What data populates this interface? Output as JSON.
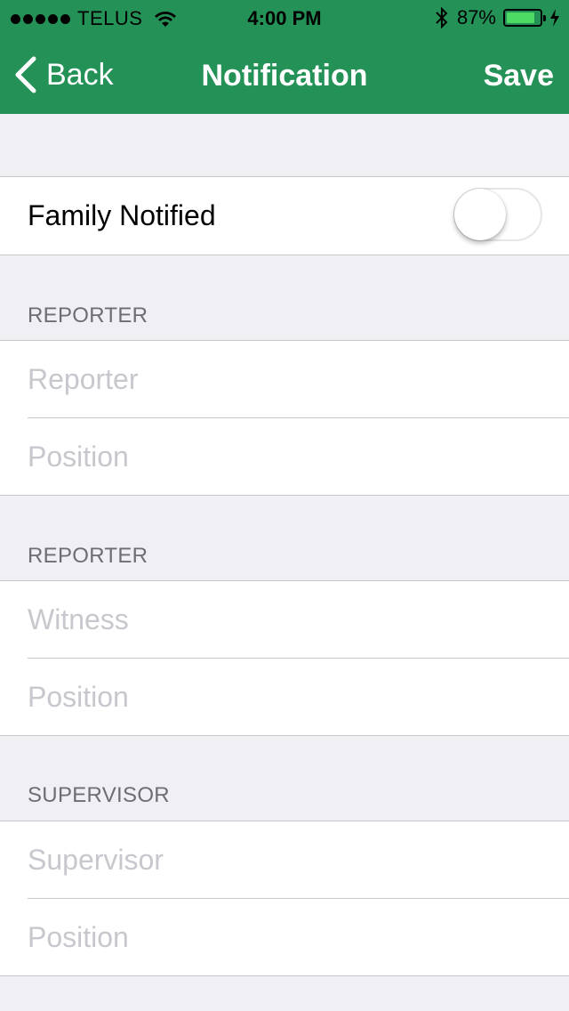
{
  "status_bar": {
    "carrier": "TELUS",
    "time": "4:00 PM",
    "battery_percent": "87%",
    "battery_level": 0.87,
    "icons": [
      "signal-dots-icon",
      "wifi-icon",
      "bluetooth-icon",
      "battery-icon",
      "charging-bolt-icon"
    ]
  },
  "nav": {
    "back_label": "Back",
    "title": "Notification",
    "save_label": "Save",
    "bar_color": "#249257"
  },
  "family_notified": {
    "label": "Family Notified",
    "on": false
  },
  "sections": [
    {
      "header": "REPORTER",
      "fields": [
        {
          "placeholder": "Reporter",
          "value": ""
        },
        {
          "placeholder": "Position",
          "value": ""
        }
      ]
    },
    {
      "header": "REPORTER",
      "fields": [
        {
          "placeholder": "Witness",
          "value": ""
        },
        {
          "placeholder": "Position",
          "value": ""
        }
      ]
    },
    {
      "header": "SUPERVISOR",
      "fields": [
        {
          "placeholder": "Supervisor",
          "value": ""
        },
        {
          "placeholder": "Position",
          "value": ""
        }
      ]
    }
  ]
}
